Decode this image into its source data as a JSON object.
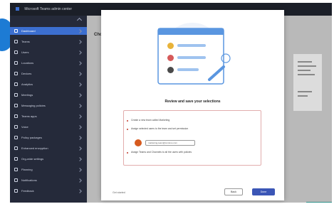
{
  "window": {
    "title": "Microsoft Teams admin center"
  },
  "sidebar": {
    "items": [
      {
        "label": "Dashboard",
        "active": true
      },
      {
        "label": "Teams"
      },
      {
        "label": "Users"
      },
      {
        "label": "Locations"
      },
      {
        "label": "Devices"
      },
      {
        "label": "Analytics"
      },
      {
        "label": "Meetings"
      },
      {
        "label": "Messaging policies"
      },
      {
        "label": "Teams apps"
      },
      {
        "label": "Voice"
      },
      {
        "label": "Policy packages"
      },
      {
        "label": "Enhanced encryption"
      },
      {
        "label": "Org-wide settings"
      },
      {
        "label": "Planning"
      },
      {
        "label": "Notifications"
      },
      {
        "label": "Feedback"
      }
    ]
  },
  "main": {
    "heading": "Cho"
  },
  "modal": {
    "title": "Review and save your selections",
    "summary": [
      "Create a new team called Marketing",
      "Assign selected users to the team and set permission",
      "Assign Teams and Channels to all the users with policies"
    ],
    "pill_text": "marketing-team@contoso.com",
    "footer_link": "Get started",
    "back_label": "Back",
    "next_label": "Done"
  },
  "colors": {
    "sidebar": "#252a3a",
    "titlebar": "#1b1f28",
    "active": "#3c6fd0",
    "primary_button": "#3b56b6",
    "accent_blue": "#1d7bd4",
    "warning_border": "#e2adad",
    "teal": "#2b8e87"
  }
}
